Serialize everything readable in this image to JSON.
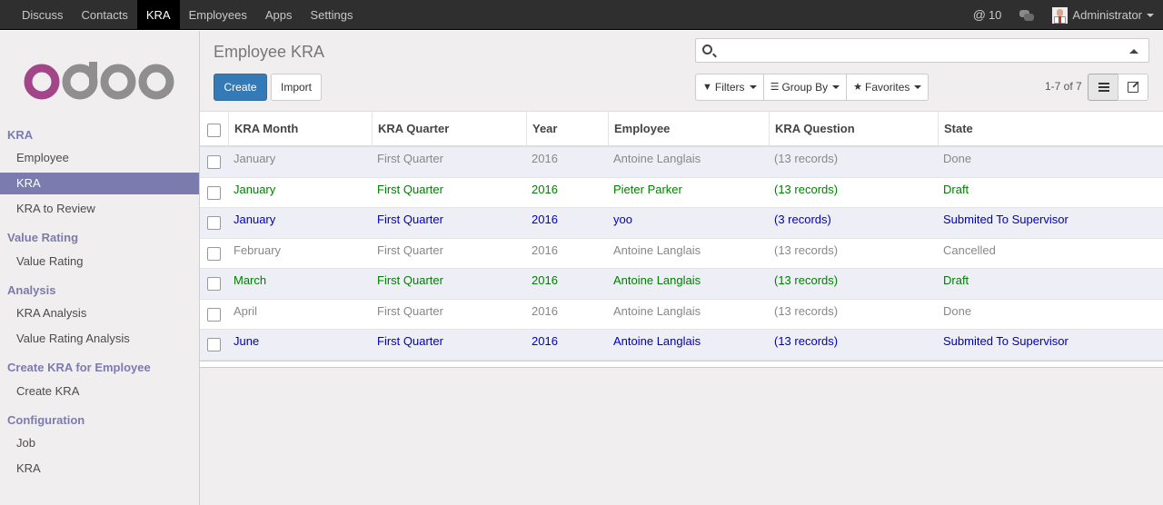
{
  "topbar": {
    "menu": [
      "Discuss",
      "Contacts",
      "KRA",
      "Employees",
      "Apps",
      "Settings"
    ],
    "active_index": 2,
    "notifications_count": "10",
    "user": "Administrator"
  },
  "sidebar": {
    "logo_text": "odoo",
    "sections": [
      {
        "title": "KRA",
        "items": [
          "Employee",
          "KRA",
          "KRA to Review"
        ]
      },
      {
        "title": "Value Rating",
        "items": [
          "Value Rating"
        ]
      },
      {
        "title": "Analysis",
        "items": [
          "KRA Analysis",
          "Value Rating Analysis"
        ]
      },
      {
        "title": "Create KRA for Employee",
        "items": [
          "Create KRA"
        ]
      },
      {
        "title": "Configuration",
        "items": [
          "Job",
          "KRA"
        ]
      }
    ],
    "active_item": "KRA"
  },
  "main": {
    "title": "Employee KRA",
    "create_label": "Create",
    "import_label": "Import",
    "search_placeholder": "",
    "filters_label": "Filters",
    "groupby_label": "Group By",
    "favorites_label": "Favorites",
    "pager": "1-7 of 7"
  },
  "table": {
    "columns": [
      "KRA Month",
      "KRA Quarter",
      "Year",
      "Employee",
      "KRA Question",
      "State"
    ],
    "rows": [
      {
        "cells": [
          "January",
          "First Quarter",
          "2016",
          "Antoine Langlais",
          "(13 records)",
          "Done"
        ],
        "color": "#888888"
      },
      {
        "cells": [
          "January",
          "First Quarter",
          "2016",
          "Pieter Parker",
          "(13 records)",
          "Draft"
        ],
        "color": "#008000"
      },
      {
        "cells": [
          "January",
          "First Quarter",
          "2016",
          "yoo",
          "(3 records)",
          "Submited To Supervisor"
        ],
        "color": "#0000bb"
      },
      {
        "cells": [
          "February",
          "First Quarter",
          "2016",
          "Antoine Langlais",
          "(13 records)",
          "Cancelled"
        ],
        "color": "#888888"
      },
      {
        "cells": [
          "March",
          "First Quarter",
          "2016",
          "Antoine Langlais",
          "(13 records)",
          "Draft"
        ],
        "color": "#008000"
      },
      {
        "cells": [
          "April",
          "First Quarter",
          "2016",
          "Antoine Langlais",
          "(13 records)",
          "Done"
        ],
        "color": "#888888"
      },
      {
        "cells": [
          "June",
          "First Quarter",
          "2016",
          "Antoine Langlais",
          "(13 records)",
          "Submited To Supervisor"
        ],
        "color": "#0000bb"
      }
    ]
  },
  "colors": {
    "accent": "#7c7bad",
    "primary_button": "#337ab7",
    "topbar": "#2f2f2f"
  },
  "icons": [
    "search-icon",
    "at-icon",
    "chat-icon",
    "list-view-icon",
    "form-view-icon",
    "star-icon",
    "filter-icon",
    "bars-icon"
  ]
}
